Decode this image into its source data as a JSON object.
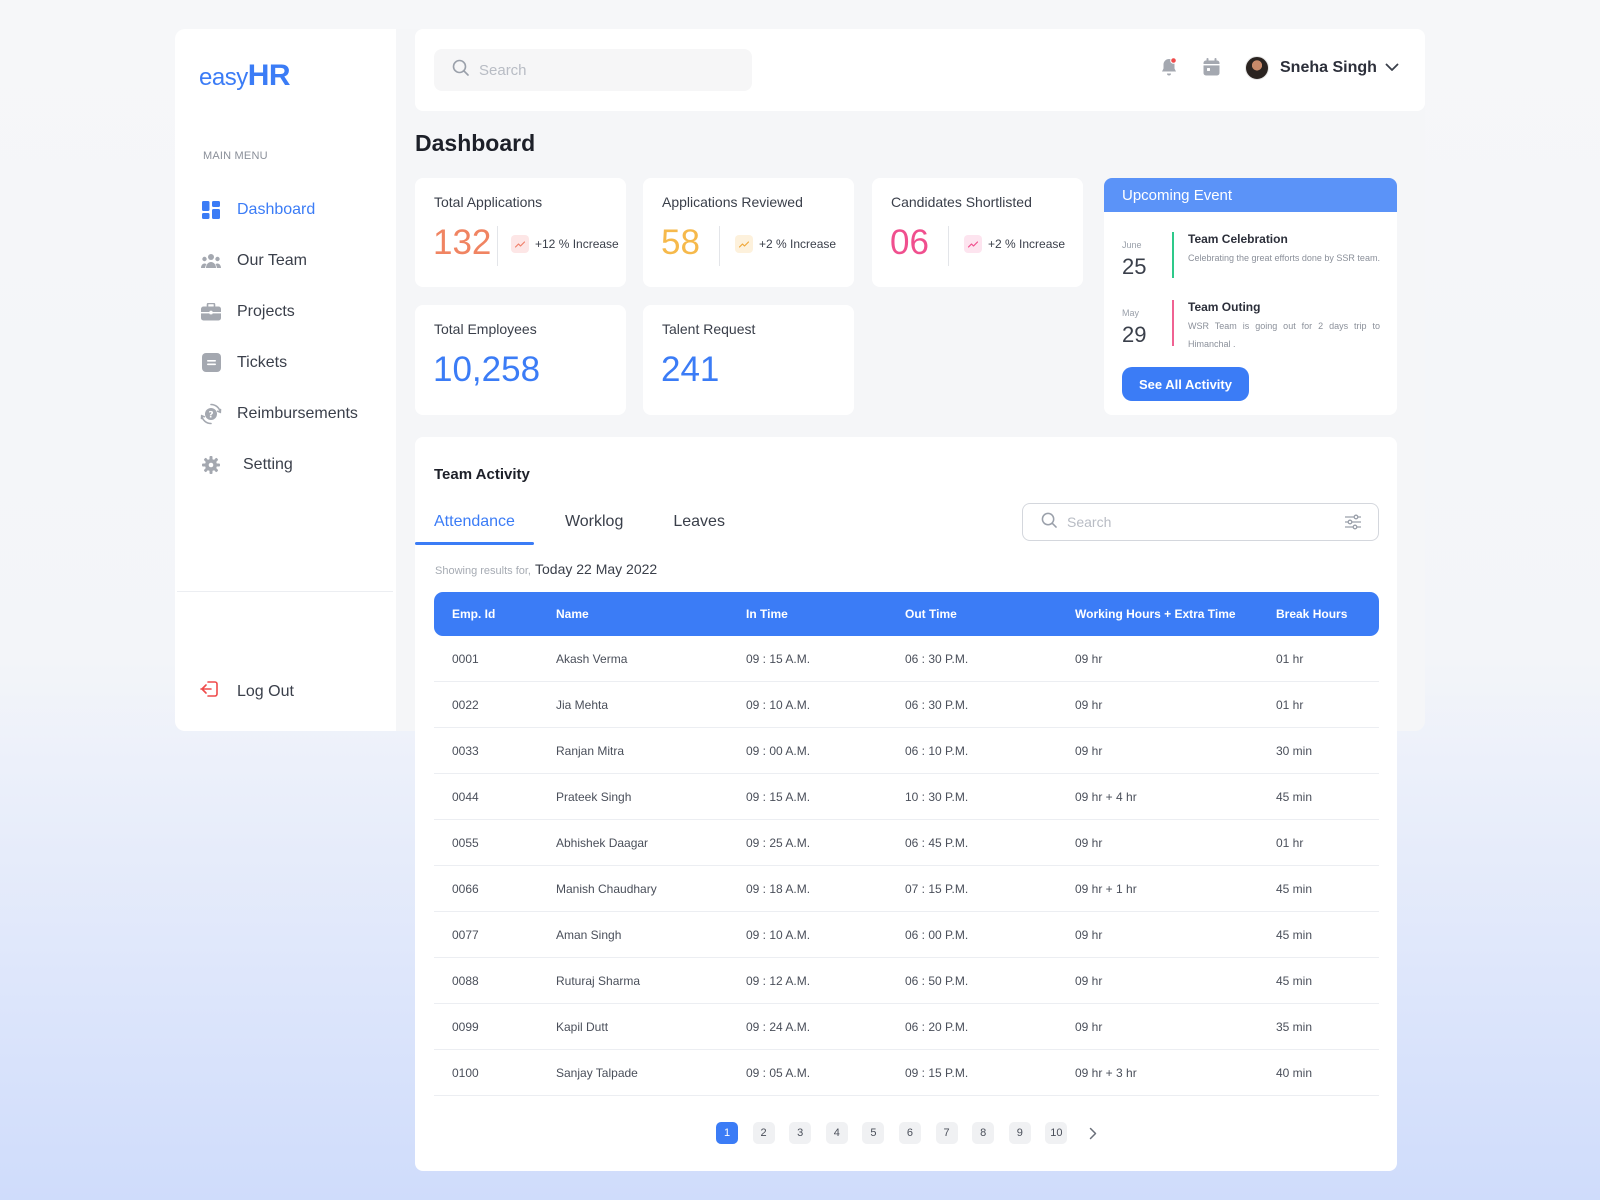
{
  "app": {
    "logo_part1": "easy",
    "logo_part2": "HR"
  },
  "colors": {
    "accent": "#3b7cf6",
    "orange": "#f08462",
    "yellow": "#f6b94b",
    "pink": "#f04f8e",
    "event_header": "#5b93f8",
    "event_bar_green": "#2ec98a",
    "event_bar_pink": "#f06292"
  },
  "sidebar": {
    "menu_label": "MAIN MENU",
    "items": [
      {
        "label": "Dashboard",
        "icon": "dashboard-icon"
      },
      {
        "label": "Our Team",
        "icon": "team-icon"
      },
      {
        "label": "Projects",
        "icon": "briefcase-icon"
      },
      {
        "label": "Tickets",
        "icon": "ticket-icon"
      },
      {
        "label": "Reimbursements",
        "icon": "reimbursement-icon"
      },
      {
        "label": "Setting",
        "icon": "gear-icon"
      }
    ],
    "logout_label": "Log Out"
  },
  "topbar": {
    "search_placeholder": "Search",
    "user_name": "Sneha Singh"
  },
  "page_title": "Dashboard",
  "stats": {
    "total_applications": {
      "title": "Total Applications",
      "value": "132",
      "trend": "+12 % Increase"
    },
    "applications_reviewed": {
      "title": "Applications Reviewed",
      "value": "58",
      "trend": "+2 % Increase"
    },
    "candidates_shortlisted": {
      "title": "Candidates Shortlisted",
      "value": "06",
      "trend": "+2 % Increase"
    },
    "total_employees": {
      "title": "Total Employees",
      "value": "10,258"
    },
    "talent_request": {
      "title": "Talent Request",
      "value": "241"
    }
  },
  "upcoming_event": {
    "title": "Upcoming Event",
    "events": [
      {
        "month": "June",
        "day": "25",
        "name": "Team Celebration",
        "desc": "Celebrating the great efforts done by SSR team."
      },
      {
        "month": "May",
        "day": "29",
        "name": "Team Outing",
        "desc": "WSR Team is going out for 2 days trip to Himanchal ."
      }
    ],
    "button_label": "See All Activity"
  },
  "team_activity": {
    "title": "Team Activity",
    "tabs": [
      "Attendance",
      "Worklog",
      "Leaves"
    ],
    "search_placeholder": "Search",
    "showing_prefix": "Showing results for,",
    "showing_date": "Today 22 May 2022",
    "columns": [
      "Emp. Id",
      "Name",
      "In Time",
      "Out Time",
      "Working Hours + Extra Time",
      "Break Hours"
    ],
    "rows": [
      [
        "0001",
        "Akash Verma",
        "09 : 15 A.M.",
        "06 : 30 P.M.",
        "09 hr",
        "01 hr"
      ],
      [
        "0022",
        "Jia Mehta",
        "09 : 10 A.M.",
        "06 : 30 P.M.",
        "09  hr",
        "01 hr"
      ],
      [
        "0033",
        "Ranjan Mitra",
        "09 : 00 A.M.",
        "06 : 10 P.M.",
        "09 hr",
        "30 min"
      ],
      [
        "0044",
        "Prateek Singh",
        "09 : 15 A.M.",
        "10 : 30 P.M.",
        "09 hr + 4 hr",
        "45 min"
      ],
      [
        "0055",
        "Abhishek Daagar",
        "09 : 25 A.M.",
        "06 : 45 P.M.",
        "09 hr",
        "01 hr"
      ],
      [
        "0066",
        "Manish Chaudhary",
        "09 : 18 A.M.",
        "07 : 15 P.M.",
        "09 hr + 1 hr",
        "45 min"
      ],
      [
        "0077",
        "Aman  Singh",
        "09 : 10 A.M.",
        "06 : 00 P.M.",
        "09 hr",
        "45 min"
      ],
      [
        "0088",
        "Ruturaj Sharma",
        "09 : 12 A.M.",
        "06 : 50 P.M.",
        "09 hr",
        "45 min"
      ],
      [
        "0099",
        "Kapil Dutt",
        "09 : 24 A.M.",
        "06 : 20 P.M.",
        "09 hr",
        "35 min"
      ],
      [
        "0100",
        "Sanjay Talpade",
        "09 : 05 A.M.",
        "09 : 15 P.M.",
        "09 hr + 3 hr",
        "40 min"
      ]
    ],
    "pages": [
      "1",
      "2",
      "3",
      "4",
      "5",
      "6",
      "7",
      "8",
      "9",
      "10"
    ],
    "current_page": "1"
  }
}
